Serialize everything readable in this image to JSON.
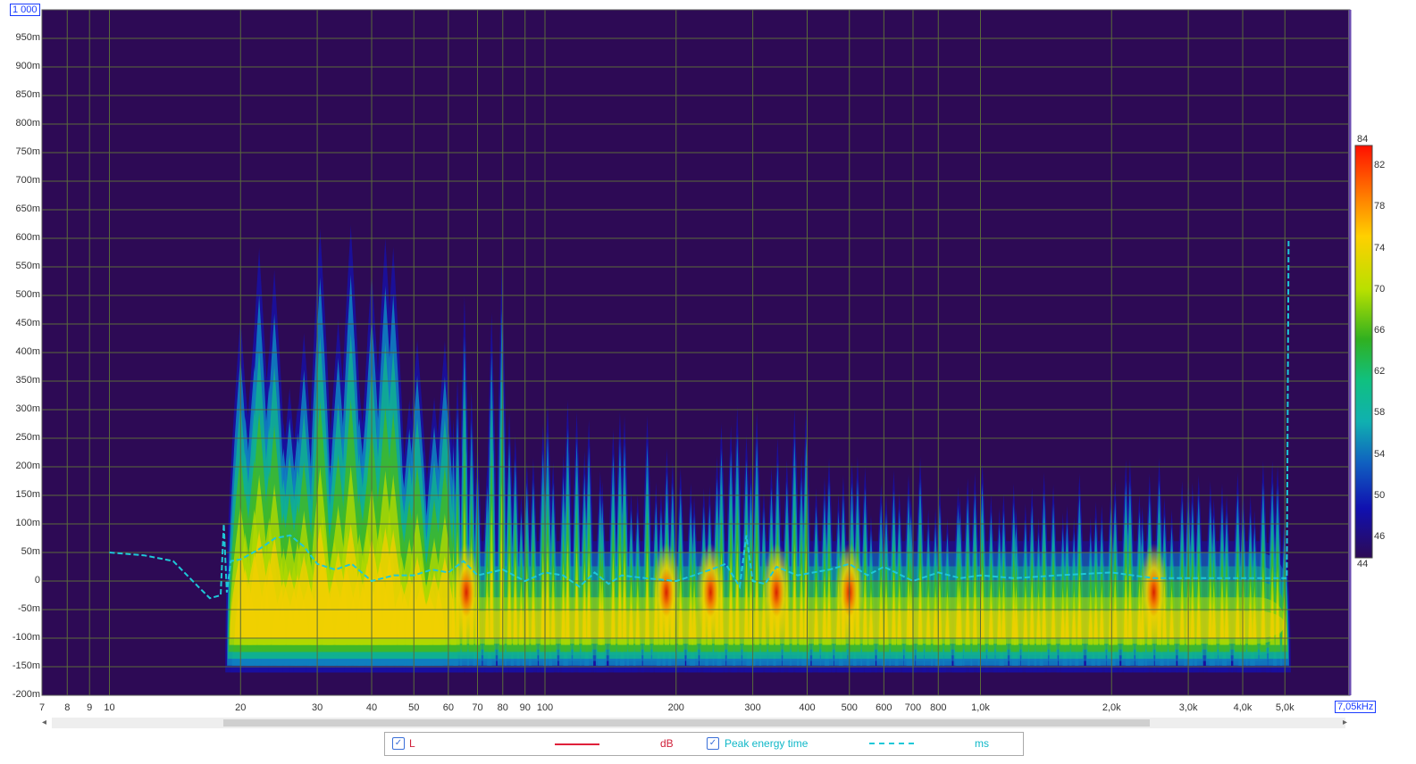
{
  "chart_data": {
    "type": "heatmap",
    "title": "",
    "x_tick_labels": [
      "7",
      "8",
      "9",
      "10",
      "20",
      "30",
      "40",
      "50",
      "60",
      "70",
      "80",
      "90",
      "100",
      "200",
      "300",
      "400",
      "500",
      "600",
      "700",
      "800",
      "1,0k",
      "2,0k",
      "3,0k",
      "4,0k",
      "5,0k",
      "7"
    ],
    "x_tick_values": [
      7,
      8,
      9,
      10,
      20,
      30,
      40,
      50,
      60,
      70,
      80,
      90,
      100,
      200,
      300,
      400,
      500,
      600,
      700,
      800,
      1000,
      2000,
      3000,
      4000,
      5000,
      7000
    ],
    "x_end_label": "7,05kHz",
    "x_range_hz": [
      7,
      7050
    ],
    "x_scale": "log",
    "y_top_label": "1 000",
    "y_tick_labels": [
      "950m",
      "900m",
      "850m",
      "800m",
      "750m",
      "700m",
      "650m",
      "600m",
      "550m",
      "500m",
      "450m",
      "400m",
      "350m",
      "300m",
      "250m",
      "200m",
      "150m",
      "100m",
      "50m",
      "0",
      "-50m",
      "-100m",
      "-150m",
      "-200m"
    ],
    "y_range_ms": [
      -200,
      1000
    ],
    "colorbar": {
      "min": 44,
      "max": 84,
      "tick_labels": [
        "84",
        "82",
        "78",
        "74",
        "70",
        "66",
        "62",
        "58",
        "54",
        "50",
        "46",
        "44"
      ],
      "tick_values": [
        84,
        82,
        78,
        74,
        70,
        66,
        62,
        58,
        54,
        50,
        46,
        44
      ]
    },
    "colors": {
      "plot_background": "#2d0a55",
      "grid": "#5a6b3a",
      "series_L": "#e0203a",
      "series_peak": "#1ec8d8"
    },
    "series": [
      {
        "name": "L",
        "unit": "dB"
      },
      {
        "name": "Peak energy time",
        "unit": "ms",
        "x": [
          10,
          12,
          14,
          16,
          17,
          18,
          18.3,
          18.6,
          19,
          20,
          22,
          24,
          26,
          28,
          30,
          33,
          36,
          40,
          45,
          50,
          55,
          60,
          65,
          70,
          80,
          90,
          100,
          110,
          120,
          130,
          140,
          150,
          170,
          200,
          220,
          240,
          260,
          280,
          290,
          300,
          320,
          340,
          380,
          450,
          500,
          550,
          600,
          700,
          800,
          900,
          1000,
          1200,
          1500,
          2000,
          2500,
          3000,
          4000,
          5000,
          5050,
          5100
        ],
        "y": [
          50,
          45,
          35,
          -10,
          -30,
          -25,
          100,
          -20,
          35,
          38,
          55,
          75,
          80,
          60,
          30,
          20,
          30,
          0,
          10,
          10,
          20,
          15,
          35,
          10,
          20,
          0,
          15,
          10,
          -10,
          15,
          -5,
          10,
          5,
          0,
          10,
          20,
          30,
          -10,
          80,
          0,
          -5,
          25,
          10,
          20,
          30,
          10,
          25,
          0,
          15,
          5,
          10,
          5,
          10,
          15,
          5,
          5,
          5,
          5,
          5,
          600
        ]
      }
    ],
    "legend_position": "bottom"
  },
  "legend": {
    "series1_label": "L",
    "series1_unit": "dB",
    "series2_label": "Peak energy time",
    "series2_unit": "ms",
    "checkbox_mark": "✓"
  },
  "scrollbar": {
    "left_arrow": "◂",
    "right_arrow": "▸"
  }
}
